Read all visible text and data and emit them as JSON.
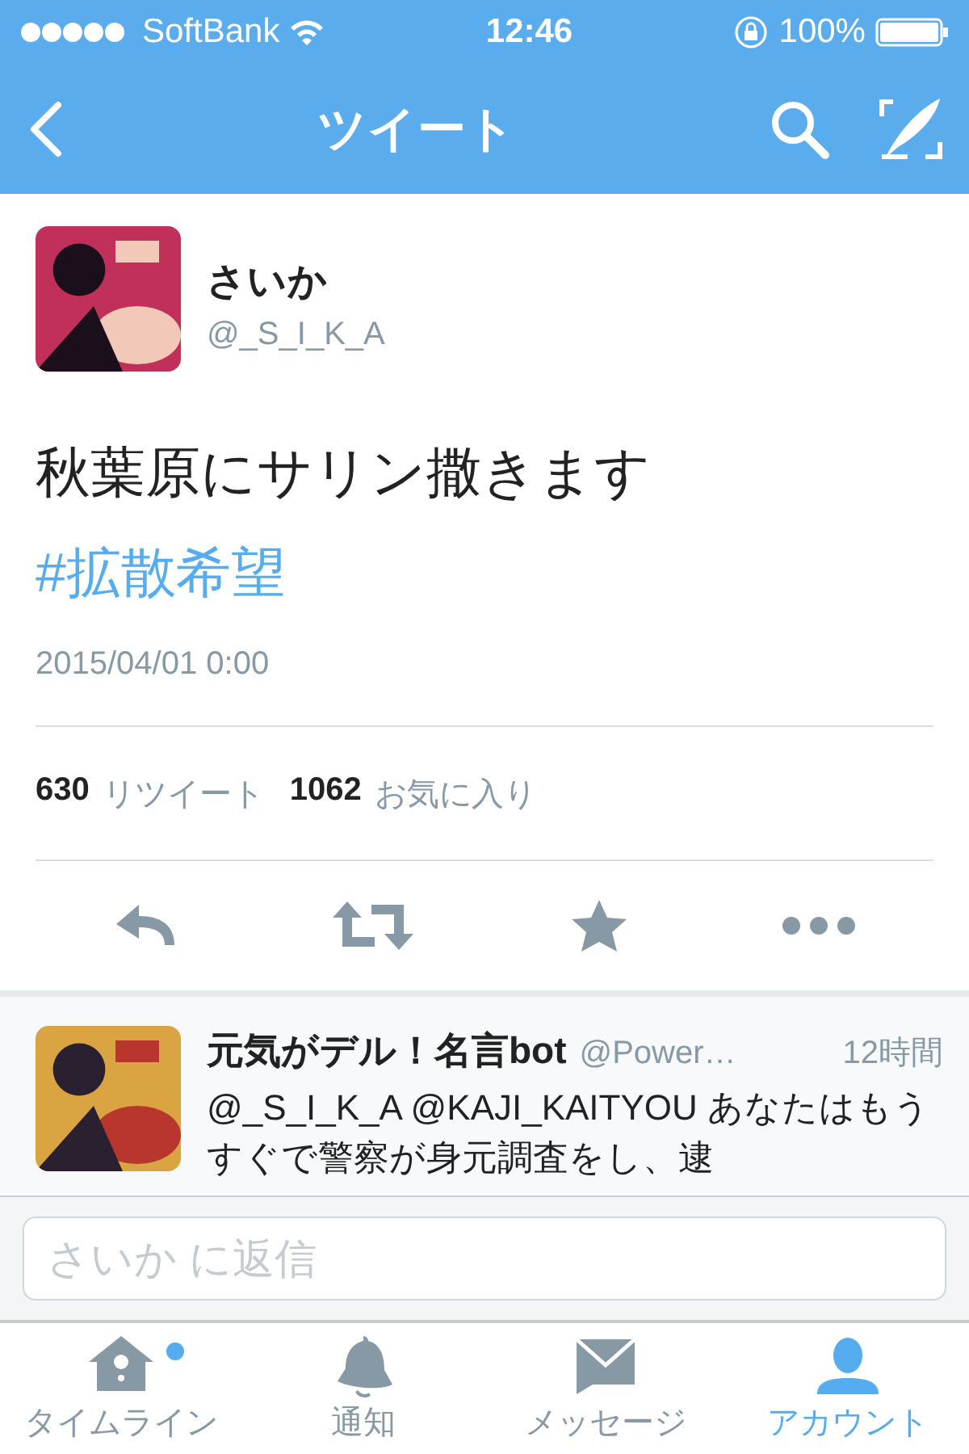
{
  "status_bar": {
    "carrier": "SoftBank",
    "time": "12:46",
    "battery": "100%"
  },
  "nav": {
    "title": "ツイート"
  },
  "tweet": {
    "name": "さいか",
    "handle": "@_S_I_K_A",
    "text": "秋葉原にサリン撒きます",
    "hashtag": "#拡散希望",
    "date": "2015/04/01 0:00",
    "stats": [
      {
        "count": "630",
        "label": "リツイート"
      },
      {
        "count": "1062",
        "label": "お気に入り"
      }
    ]
  },
  "reply": {
    "name": "元気がデル！名言bot",
    "handle": "@Power…",
    "time": "12時間",
    "text": "@_S_I_K_A @KAJI_KAITYOU あなたはもうすぐで警察が身元調査をし、逮"
  },
  "reply_field": {
    "placeholder": "さいか に返信"
  },
  "tab_bar": [
    {
      "kind": "home",
      "label": "タイムライン",
      "selected": false,
      "badge": true
    },
    {
      "kind": "bell",
      "label": "通知",
      "selected": false,
      "badge": false
    },
    {
      "kind": "mail",
      "label": "メッセージ",
      "selected": false,
      "badge": false
    },
    {
      "kind": "person",
      "label": "アカウント",
      "selected": true,
      "badge": false
    }
  ]
}
